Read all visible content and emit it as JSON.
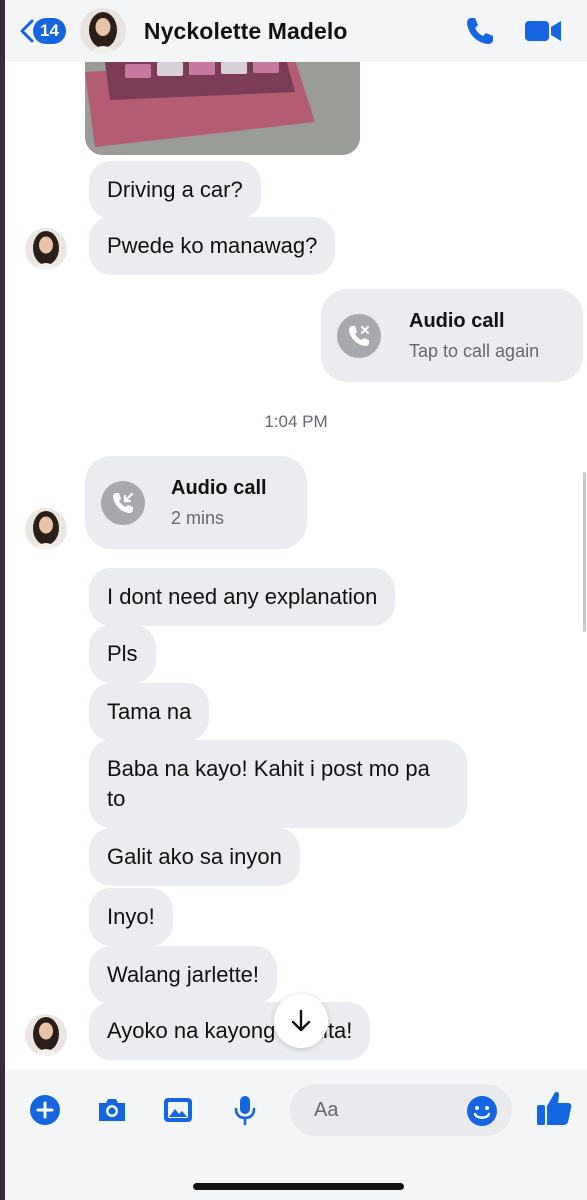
{
  "header": {
    "badge_count": "14",
    "contact_name": "Nyckolette Madelo",
    "icons": [
      "back-chevron-icon",
      "phone-icon",
      "video-camera-icon"
    ]
  },
  "messages": {
    "m1": "Driving a car?",
    "m2": "Pwede ko manawag?",
    "call_out_title": "Audio call",
    "call_out_sub": "Tap to call again",
    "timestamp": "1:04 PM",
    "call_in_title": "Audio call",
    "call_in_sub": "2 mins",
    "m3": "I dont need any explanation",
    "m4": "Pls",
    "m5": "Tama na",
    "m6": "Baba na kayo! Kahit i post mo pa to",
    "m7": "Galit ako sa inyon",
    "m8": "Inyo!",
    "m9": "Walang jarlette!",
    "m10": "Ayoko na kayong makita!"
  },
  "composer": {
    "placeholder": "Aa",
    "icons": [
      "plus-icon",
      "camera-icon",
      "gallery-icon",
      "microphone-icon",
      "emoji-icon",
      "like-icon"
    ]
  },
  "colors": {
    "accent": "#1565e0",
    "bubble": "#ebecef",
    "header_bg": "#f4f5f7"
  }
}
